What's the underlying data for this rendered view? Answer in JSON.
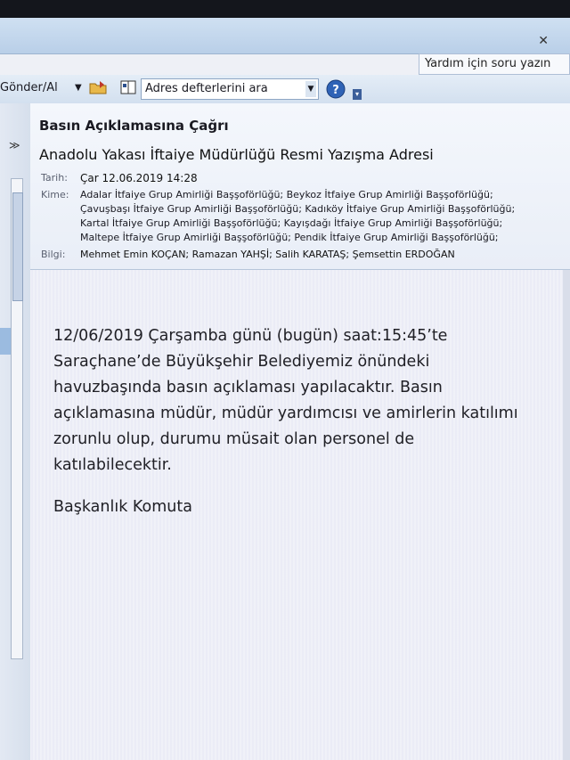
{
  "window": {
    "close_icon": "close-icon"
  },
  "search": {
    "help_placeholder": "Yardım için soru yazın"
  },
  "toolbar": {
    "send_receive_label": "Gönder/Al",
    "address_book_placeholder": "Adres defterlerini ara",
    "icons": [
      "folder-icon",
      "address-book-icon",
      "help-icon"
    ]
  },
  "email": {
    "subject": "Basın Açıklamasına Çağrı",
    "from": "Anadolu Yakası İftaiye Müdürlüğü Resmi Yazışma Adresi",
    "date_label": "Tarih:",
    "date": "Çar 12.06.2019 14:28",
    "to_label": "Kime:",
    "to_lines": [
      "Adalar İtfaiye Grup Amirliği Başşoförlüğü; Beykoz İtfaiye Grup Amirliği Başşoförlüğü;",
      "Çavuşbaşı İtfaiye Grup Amirliği Başşoförlüğü; Kadıköy İtfaiye Grup Amirliği Başşoförlüğü;",
      "Kartal İtfaiye Grup Amirliği Başşoförlüğü; Kayışdağı İtfaiye Grup Amirliği Başşoförlüğü;",
      "Maltepe İtfaiye Grup Amirliği Başşoförlüğü; Pendik İtfaiye Grup Amirliği Başşoförlüğü;"
    ],
    "cc_label": "Bilgi:",
    "cc": "Mehmet Emin KOÇAN; Ramazan YAHŞİ; Salih KARATAŞ; Şemsettin ERDOĞAN",
    "body": "12/06/2019 Çarşamba günü (bugün) saat:15:45’te Saraçhane’de Büyükşehir Belediyemiz önündeki havuzbaşında basın açıklaması yapılacaktır. Basın açıklamasına müdür, müdür yardımcısı ve amirlerin katılımı zorunlu olup, durumu müsait olan personel de katılabilecektir.",
    "signature": "Başkanlık Komuta"
  }
}
